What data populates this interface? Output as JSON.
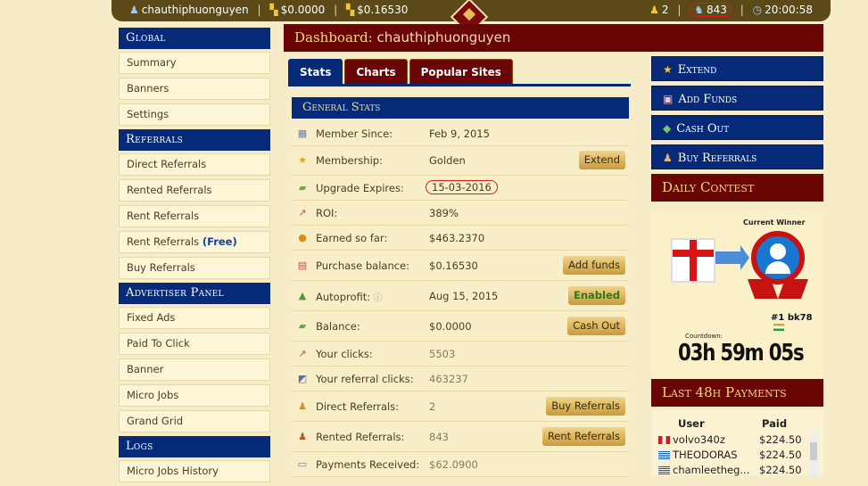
{
  "topbar": {
    "username": "chauthiphuonguyen",
    "balance1": "$0.0000",
    "balance2": "$0.16530",
    "count1": "2",
    "count2": "843",
    "time": "20:00:58"
  },
  "sidebar": {
    "global_title": "Global",
    "global_items": [
      "Summary",
      "Banners",
      "Settings"
    ],
    "referrals_title": "Referrals",
    "referral_items": [
      "Direct Referrals",
      "Rented Referrals",
      "Rent Referrals",
      "Rent Referrals",
      "Buy Referrals"
    ],
    "free_tag": "(Free)",
    "advertiser_title": "Advertiser Panel",
    "advertiser_items": [
      "Fixed Ads",
      "Paid To Click",
      "Banner",
      "Micro Jobs",
      "Grand Grid"
    ],
    "logs_title": "Logs",
    "logs_items": [
      "Micro Jobs History"
    ]
  },
  "header": {
    "title": "Dashboard:",
    "username": "chauthiphuonguyen"
  },
  "tabs": [
    "Stats",
    "Charts",
    "Popular Sites"
  ],
  "general_stats": {
    "title": "General Stats",
    "rows": [
      {
        "label": "Member Since:",
        "value": "Feb 9, 2015",
        "button": ""
      },
      {
        "label": "Membership:",
        "value": "Golden",
        "button": "Extend"
      },
      {
        "label": "Upgrade Expires:",
        "value": "15-03-2016",
        "button": ""
      },
      {
        "label": "ROI:",
        "value": "389%",
        "button": ""
      },
      {
        "label": "Earned so far:",
        "value": "$463.2370",
        "button": ""
      },
      {
        "label": "Purchase balance:",
        "value": "$0.16530",
        "button": "Add funds"
      },
      {
        "label": "Autoprofit:",
        "value": "Aug 15, 2015",
        "button": "Enabled"
      },
      {
        "label": "Balance:",
        "value": "$0.0000",
        "button": "Cash Out"
      },
      {
        "label": "Your clicks:",
        "value": "5503",
        "button": ""
      },
      {
        "label": "Your referral clicks:",
        "value": "463237",
        "button": ""
      },
      {
        "label": "Direct Referrals:",
        "value": "2",
        "button": "Buy Referrals"
      },
      {
        "label": "Rented Referrals:",
        "value": "843",
        "button": "Rent Referrals"
      },
      {
        "label": "Payments Received:",
        "value": "$62.0900",
        "button": ""
      }
    ]
  },
  "right": {
    "buttons": [
      "Extend",
      "Add Funds",
      "Cash Out",
      "Buy Referrals"
    ],
    "contest_title": "Daily Contest",
    "current_winner": "Current Winner",
    "winner_name": "#1 bk78",
    "countdown_label": "Countdown:",
    "countdown": "03h 59m 05s",
    "payments_title": "Last 48h Payments",
    "payments_headers": [
      "User",
      "Paid"
    ],
    "payments": [
      {
        "user": "volvo340z",
        "paid": "$224.50"
      },
      {
        "user": "THEODORAS",
        "paid": "$224.50"
      },
      {
        "user": "chamleetheg...",
        "paid": "$224.50"
      }
    ]
  }
}
